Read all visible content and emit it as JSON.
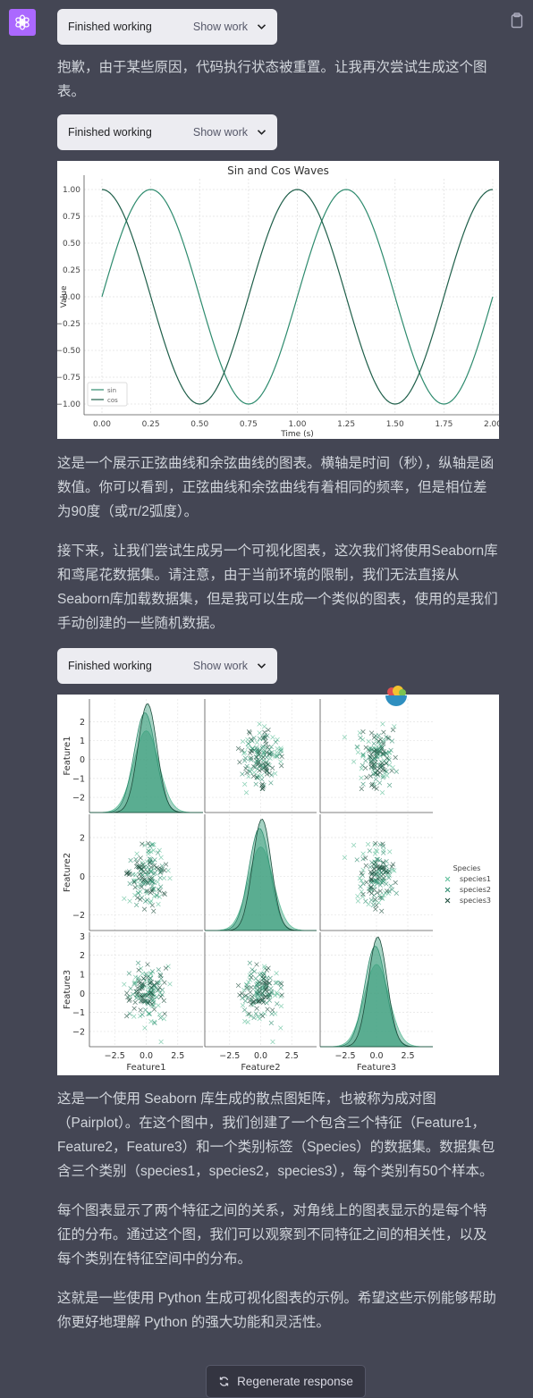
{
  "assistant": {
    "avatar_icon": "openai-logo-icon",
    "avatar_color": "#ab68ff",
    "copy_icon": "clipboard-icon"
  },
  "work_blocks": [
    {
      "status": "Finished working",
      "toggle_label": "Show work"
    },
    {
      "status": "Finished working",
      "toggle_label": "Show work"
    },
    {
      "status": "Finished working",
      "toggle_label": "Show work"
    }
  ],
  "messages": {
    "p1": "抱歉，由于某些原因，代码执行状态被重置。让我再次尝试生成这个图表。",
    "p2": "这是一个展示正弦曲线和余弦曲线的图表。横轴是时间（秒），纵轴是函数值。你可以看到，正弦曲线和余弦曲线有着相同的频率，但是相位差为90度（或π/2弧度）。",
    "p3": "接下来，让我们尝试生成另一个可视化图表，这次我们将使用Seaborn库和鸢尾花数据集。请注意，由于当前环境的限制，我们无法直接从Seaborn库加载数据集，但是我可以生成一个类似的图表，使用的是我们手动创建的一些随机数据。",
    "p4": "这是一个使用 Seaborn 库生成的散点图矩阵，也被称为成对图（Pairplot）。在这个图中，我们创建了一个包含三个特征（Feature1，Feature2，Feature3）和一个类别标签（Species）的数据集。数据集包含三个类别（species1，species2，species3），每个类别有50个样本。",
    "p5": "每个图表显示了两个特征之间的关系，对角线上的图表显示的是每个特征的分布。通过这个图，我们可以观察到不同特征之间的相关性，以及每个类别在特征空间中的分布。",
    "p6": "这就是一些使用 Python 生成可视化图表的示例。希望这些示例能够帮助你更好地理解 Python 的强大功能和灵活性。"
  },
  "regenerate": {
    "label": "Regenerate response",
    "icon": "refresh-icon"
  },
  "chart_data": [
    {
      "type": "line",
      "title": "Sin and Cos Waves",
      "xlabel": "Time (s)",
      "ylabel": "Value",
      "xlim": [
        0,
        2
      ],
      "ylim": [
        -1.1,
        1.1
      ],
      "xticks": [
        "0.00",
        "0.25",
        "0.50",
        "0.75",
        "1.00",
        "1.25",
        "1.50",
        "1.75",
        "2.00"
      ],
      "yticks": [
        "-1.00",
        "-0.75",
        "-0.50",
        "-0.25",
        "0.00",
        "0.25",
        "0.50",
        "0.75",
        "1.00"
      ],
      "grid": true,
      "legend_position": "lower-left",
      "series": [
        {
          "name": "sin",
          "function": "sin(2*pi*t)",
          "color": "#2e8b6e"
        },
        {
          "name": "cos",
          "function": "cos(2*pi*t)",
          "color": "#1f5f4a"
        }
      ]
    },
    {
      "type": "scatter",
      "subtype": "pairplot",
      "features": [
        "Feature1",
        "Feature2",
        "Feature3"
      ],
      "hue_title": "Species",
      "hue_labels": [
        "species1",
        "species2",
        "species3"
      ],
      "hue_colors": [
        "#5fbf9a",
        "#2e8b6e",
        "#1f4d3d"
      ],
      "samples_per_class": 50,
      "marker": "x",
      "diag_kind": "kde",
      "axis_ticks": {
        "Feature1": [
          "-2",
          "-1",
          "0",
          "1",
          "2"
        ],
        "Feature2": [
          "-2",
          "0",
          "2"
        ],
        "Feature3": [
          "-2",
          "-1",
          "0",
          "1",
          "2",
          "3"
        ],
        "x": [
          "-2.5",
          "0.0",
          "2.5"
        ]
      },
      "range": [
        -4.5,
        4.5
      ],
      "grid": true,
      "legend_position": "right"
    }
  ]
}
